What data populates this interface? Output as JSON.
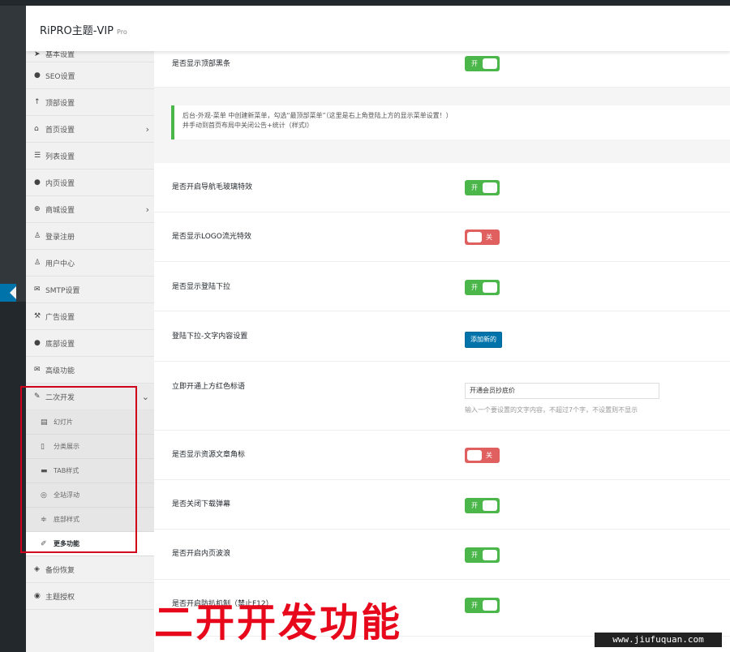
{
  "header": {
    "title": "RiPRO主题-VIP",
    "badge": "Pro"
  },
  "sidebar": {
    "items": [
      {
        "label": "基本设置",
        "icon": "paper-plane-icon"
      },
      {
        "label": "SEO设置",
        "icon": "dot-icon"
      },
      {
        "label": "顶部设置",
        "icon": "arrow-up-icon"
      },
      {
        "label": "首页设置",
        "icon": "home-icon",
        "has_children": true
      },
      {
        "label": "列表设置",
        "icon": "list-icon"
      },
      {
        "label": "内页设置",
        "icon": "dot-icon"
      },
      {
        "label": "商城设置",
        "icon": "plus-circle-icon",
        "has_children": true
      },
      {
        "label": "登录注册",
        "icon": "user-icon"
      },
      {
        "label": "用户中心",
        "icon": "user-icon"
      },
      {
        "label": "SMTP设置",
        "icon": "envelope-icon"
      },
      {
        "label": "广告设置",
        "icon": "gavel-icon"
      },
      {
        "label": "底部设置",
        "icon": "dot-icon"
      },
      {
        "label": "高级功能",
        "icon": "envelope-icon"
      },
      {
        "label": "二次开发",
        "icon": "magic-icon",
        "expanded": true
      }
    ],
    "submenu": [
      {
        "label": "幻灯片",
        "icon": "film-icon"
      },
      {
        "label": "分类展示",
        "icon": "bookmark-icon"
      },
      {
        "label": "TAB样式",
        "icon": "folder-icon"
      },
      {
        "label": "全站浮动",
        "icon": "life-ring-icon"
      },
      {
        "label": "底部样式",
        "icon": "sliders-icon"
      },
      {
        "label": "更多功能",
        "icon": "pencil-icon",
        "active": true
      }
    ],
    "footer_items": [
      {
        "label": "备份恢复",
        "icon": "shield-icon"
      },
      {
        "label": "主题授权",
        "icon": "eye-icon"
      }
    ]
  },
  "main": {
    "rows": [
      {
        "label": "是否显示顶部黑条",
        "type": "toggle",
        "on": true
      },
      {
        "label": "是否开启导航毛玻璃特效",
        "type": "toggle",
        "on": true
      },
      {
        "label": "是否显示LOGO流光特效",
        "type": "toggle",
        "on": false
      },
      {
        "label": "是否显示登陆下拉",
        "type": "toggle",
        "on": true
      },
      {
        "label": "登陆下拉-文字内容设置",
        "type": "button",
        "button": "添加新的"
      },
      {
        "label": "立即开通上方红色标语",
        "type": "input",
        "value": "开通会员抄底价",
        "hint": "输入一个要设置的文字内容，不超过7个字，不设置则不显示"
      },
      {
        "label": "是否显示资源文章角标",
        "type": "toggle",
        "on": false
      },
      {
        "label": "是否关闭下载弹幕",
        "type": "toggle",
        "on": true
      },
      {
        "label": "是否开启内页波浪",
        "type": "toggle",
        "on": true
      },
      {
        "label": "是否开启防扒机制（禁止F12）",
        "type": "toggle",
        "on": true
      }
    ],
    "notice": {
      "line1": "后台-外观-菜单 中创建新菜单，勾选“最顶部菜单”（这里是右上角登陆上方的显示菜单设置！）",
      "line2": "并手动到首页布局中关闭公告+统计（样式Ⅰ）"
    },
    "toggle_on_label": "开",
    "toggle_off_label": "关"
  },
  "watermark": "二开开发功能",
  "site_tag": "www.jiufuquan.com",
  "colors": {
    "toggle_on": "#4bb649",
    "toggle_off": "#e06060",
    "primary": "#0073aa",
    "highlight": "#d0021b"
  }
}
